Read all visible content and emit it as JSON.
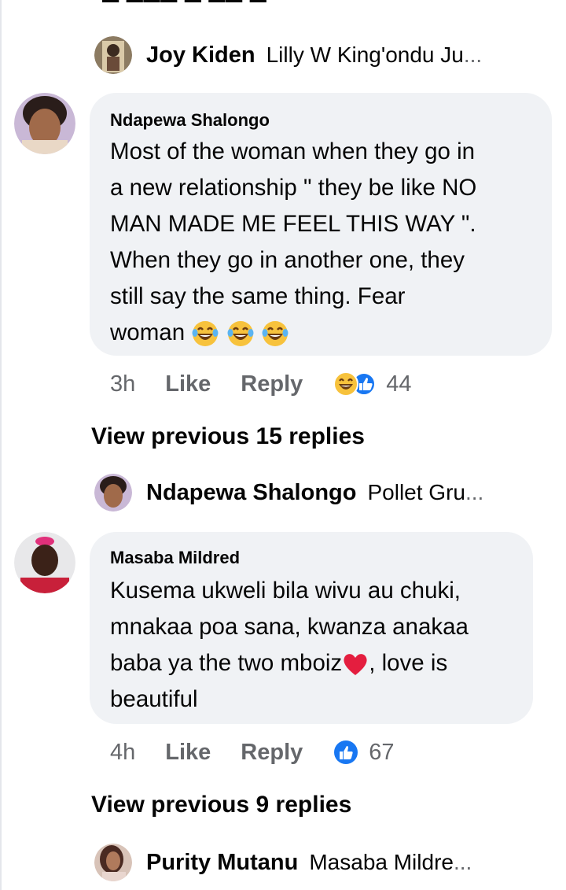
{
  "thread": {
    "top_preview": {
      "name": "Joy Kiden",
      "snippet": "Lilly W King'ondu Ju",
      "ellipsis": "..."
    },
    "comment1": {
      "author": "Ndapewa Shalongo",
      "lines": [
        "Most of the woman when they go in",
        "a new relationship \" they be like NO",
        "MAN MADE ME FEEL THIS WAY \".",
        "When they go in another one, they",
        "still say the same thing.  Fear",
        "woman"
      ],
      "time": "3h",
      "like_label": "Like",
      "reply_label": "Reply",
      "reaction_count": "44"
    },
    "view_previous_1": "View previous 15 replies",
    "preview2": {
      "name": "Ndapewa Shalongo",
      "snippet": "Pollet Gru",
      "ellipsis": "..."
    },
    "comment2": {
      "author": "Masaba Mildred",
      "lines": [
        "Kusema ukweli bila wivu au chuki,",
        "mnakaa poa sana, kwanza anakaa",
        "baba ya the two mboiz",
        "beautiful"
      ],
      "line3_suffix": ", love is",
      "time": "4h",
      "like_label": "Like",
      "reply_label": "Reply",
      "reaction_count": "67"
    },
    "view_previous_2": "View previous 9 replies",
    "preview3": {
      "name": "Purity Mutanu",
      "snippet": "Masaba Mildre",
      "ellipsis": "..."
    }
  },
  "colors": {
    "bubble_bg": "#f0f2f5",
    "secondary_text": "#65676b",
    "like_blue": "#1877f2",
    "heart_red": "#e41e3f",
    "emoji_yellow": "#f7c23c"
  }
}
